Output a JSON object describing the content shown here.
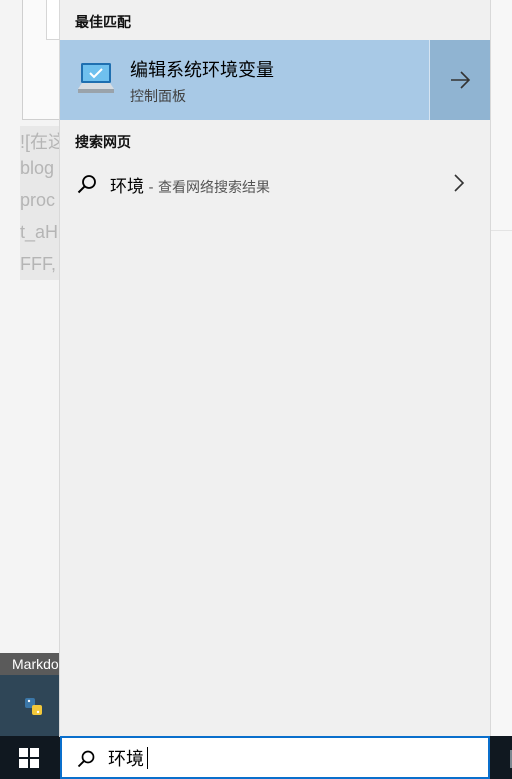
{
  "background_app": {
    "lines": [
      "![在这",
      "blog",
      "proc",
      "t_aH",
      "FFF,"
    ]
  },
  "taskbar": {
    "app_label": "Markdo"
  },
  "search_panel": {
    "best_match_heading": "最佳匹配",
    "best_match": {
      "title": "编辑系统环境变量",
      "subtitle": "控制面板",
      "icon": "monitor-settings-icon",
      "open_icon": "arrow-right-icon"
    },
    "web_heading": "搜索网页",
    "web_result": {
      "query": "环境",
      "hint": " - 查看网络搜索结果",
      "icon": "search-icon",
      "more_icon": "chevron-right-icon"
    }
  },
  "search_box": {
    "value": "环境",
    "icon": "search-icon"
  },
  "colors": {
    "selected_row": "#a8c9e6",
    "arrow_cell": "#90b4d2",
    "focus_border": "#0a6fcc",
    "taskbar": "#101820"
  }
}
